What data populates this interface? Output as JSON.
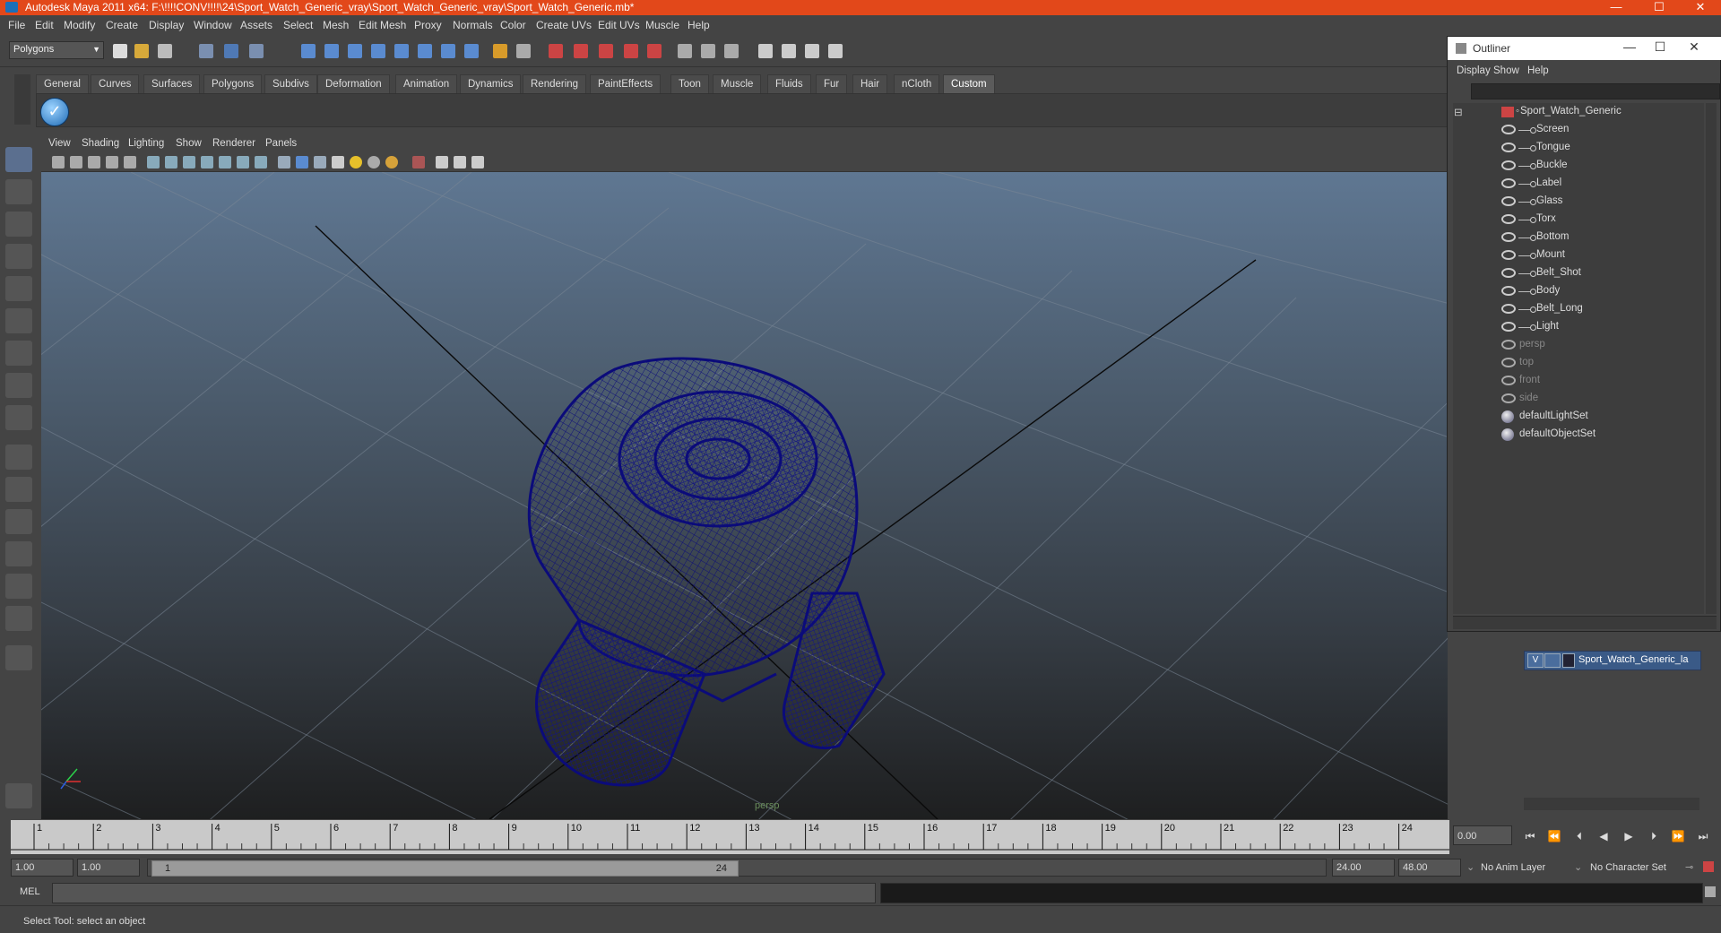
{
  "window": {
    "title": "Autodesk Maya 2011 x64: F:\\!!!!CONV!!!!\\24\\Sport_Watch_Generic_vray\\Sport_Watch_Generic_vray\\Sport_Watch_Generic.mb*",
    "minimize": "—",
    "maximize": "☐",
    "close": "✕"
  },
  "menubar": [
    "File",
    "Edit",
    "Modify",
    "Create",
    "Display",
    "Window",
    "Assets",
    "Select",
    "Mesh",
    "Edit Mesh",
    "Proxy",
    "Normals",
    "Color",
    "Create UVs",
    "Edit UVs",
    "Muscle",
    "Help"
  ],
  "status": {
    "mode": "Polygons"
  },
  "shelf": {
    "tabs": [
      "General",
      "Curves",
      "Surfaces",
      "Polygons",
      "Subdivs",
      "Deformation",
      "Animation",
      "Dynamics",
      "Rendering",
      "PaintEffects",
      "Toon",
      "Muscle",
      "Fluids",
      "Fur",
      "Hair",
      "nCloth",
      "Custom"
    ],
    "active_tab": "Custom"
  },
  "viewport": {
    "menu": [
      "View",
      "Shading",
      "Lighting",
      "Show",
      "Renderer",
      "Panels"
    ],
    "camera_label": "persp",
    "wire_color": "#0b0b7a"
  },
  "outliner": {
    "title": "Outliner",
    "menu": [
      "Display",
      "Show",
      "Help"
    ],
    "root": "Sport_Watch_Generic",
    "children": [
      "Screen",
      "Tongue",
      "Buckle",
      "Label",
      "Glass",
      "Torx",
      "Bottom",
      "Mount",
      "Belt_Shot",
      "Body",
      "Belt_Long",
      "Light"
    ],
    "cameras": [
      "persp",
      "top",
      "front",
      "side"
    ],
    "sets": [
      "defaultLightSet",
      "defaultObjectSet"
    ]
  },
  "layers": {
    "visible_flag": "V",
    "layer_name": "Sport_Watch_Generic_la"
  },
  "timeline": {
    "ticks": [
      "1",
      "2",
      "3",
      "4",
      "5",
      "6",
      "7",
      "8",
      "9",
      "10",
      "11",
      "12",
      "13",
      "14",
      "15",
      "16",
      "17",
      "18",
      "19",
      "20",
      "21",
      "22",
      "23",
      "24"
    ],
    "current_time": "0.00"
  },
  "range": {
    "start": "1.00",
    "start_inner": "1.00",
    "range_start_label": "1",
    "range_end_label": "24",
    "end": "24.00",
    "end_outer": "48.00",
    "anim_layer": "No Anim Layer",
    "character_set": "No Character Set"
  },
  "command": {
    "label": "MEL"
  },
  "help": {
    "text": "Select Tool: select an object"
  }
}
